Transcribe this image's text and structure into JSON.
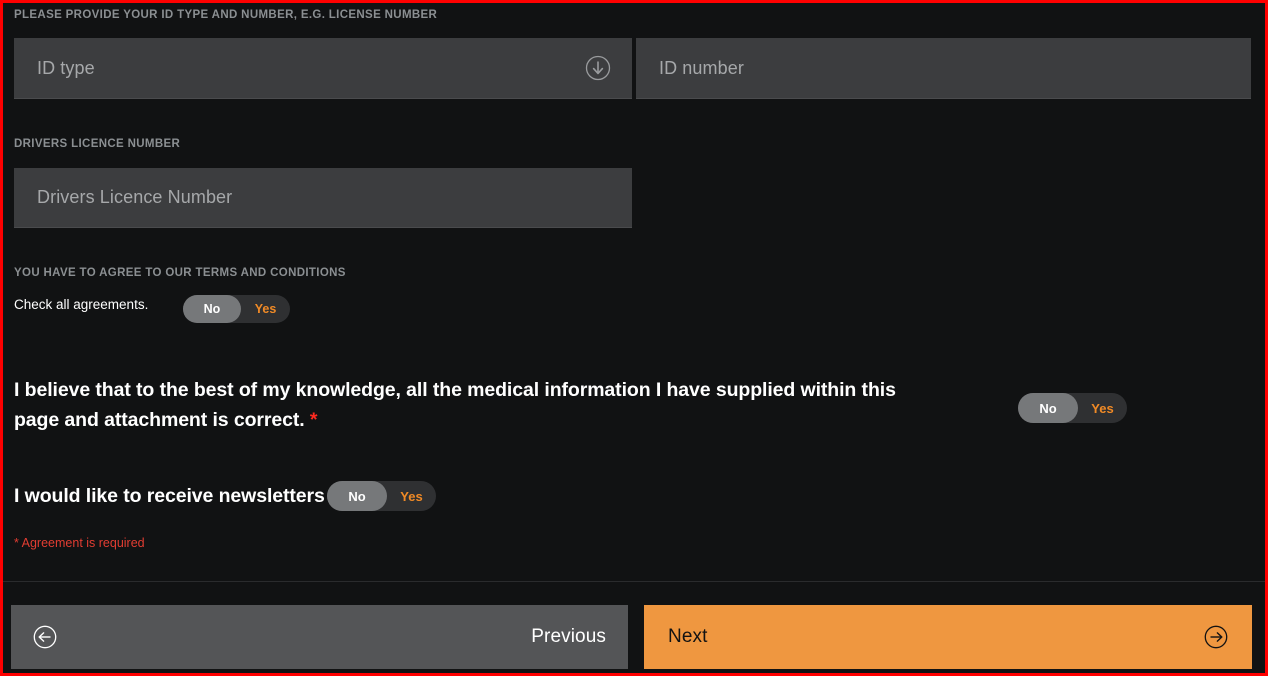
{
  "theme": {
    "page_background": "#111213",
    "border_color": "#ff0000",
    "field_background": "#3c3d3f",
    "accent_orange": "#ef9740",
    "toggle_track": "#2f3032",
    "toggle_knob": "#76787a",
    "error_red": "#e23d32",
    "label_gray": "#8b8f92"
  },
  "sections": {
    "id_section": {
      "label": "PLEASE PROVIDE YOUR ID TYPE AND NUMBER, E.G. LICENSE NUMBER",
      "id_type": {
        "placeholder": "ID type",
        "value": "",
        "icon": "circle-arrow-down-icon"
      },
      "id_number": {
        "placeholder": "ID number",
        "value": ""
      }
    },
    "licence_section": {
      "label": "DRIVERS LICENCE NUMBER",
      "licence_number": {
        "placeholder": "Drivers Licence Number",
        "value": ""
      }
    },
    "terms_section": {
      "label": "YOU HAVE TO AGREE TO OUR TERMS AND CONDITIONS",
      "check_all": {
        "label": "Check all agreements.",
        "toggle": {
          "off_label": "No",
          "on_label": "Yes",
          "state": "No"
        }
      },
      "agreements": [
        {
          "text": "I believe that to the best of my knowledge, all the medical information I have supplied within this page and attachment is correct.",
          "required_marker": "*",
          "toggle": {
            "off_label": "No",
            "on_label": "Yes",
            "state": "No"
          }
        },
        {
          "text": "I would like to receive newsletters",
          "required_marker": "",
          "toggle": {
            "off_label": "No",
            "on_label": "Yes",
            "state": "No"
          }
        }
      ],
      "error": "* Agreement is required"
    }
  },
  "footer": {
    "previous": {
      "label": "Previous",
      "icon": "circle-arrow-left-icon"
    },
    "next": {
      "label": "Next",
      "icon": "circle-arrow-right-icon"
    }
  }
}
